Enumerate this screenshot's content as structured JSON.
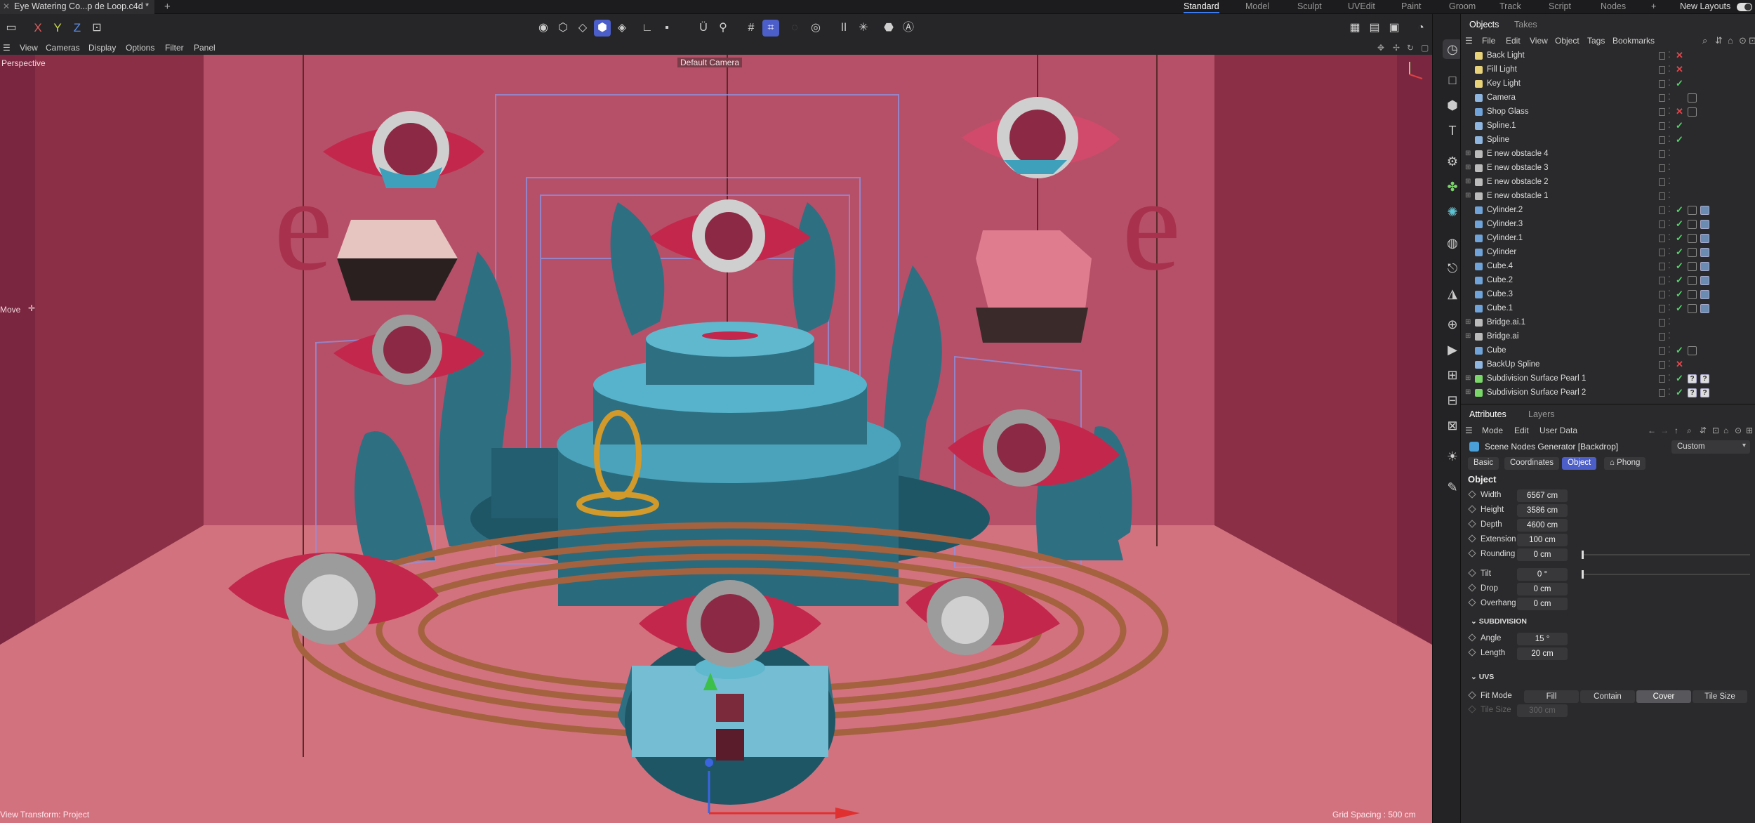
{
  "title_bar": {
    "document_tab": "Eye Watering Co...p de Loop.c4d *",
    "layouts": [
      "Standard",
      "Model",
      "Sculpt",
      "UVEdit",
      "Paint",
      "Groom",
      "Track",
      "Script",
      "Nodes"
    ],
    "active_layout": "Standard",
    "new_layouts_label": "New Layouts"
  },
  "toolbar": {
    "axis_x": "X",
    "axis_y": "Y",
    "axis_z": "Z"
  },
  "view_menu": [
    "View",
    "Cameras",
    "Display",
    "Options",
    "Filter",
    "Panel"
  ],
  "viewport": {
    "view_name": "Perspective",
    "camera_label": "Default Camera",
    "tool_label": "Move",
    "status_left": "View Transform: Project",
    "status_right": "Grid Spacing : 500 cm",
    "colors": {
      "wall": "#b9546c",
      "floor": "#d27380",
      "teal": "#2f6f82",
      "light_teal": "#6fb6cb",
      "eye_red": "#c3284c",
      "copper": "#a4623e"
    }
  },
  "object_manager": {
    "tabs": [
      "Objects",
      "Takes"
    ],
    "menu": [
      "File",
      "Edit",
      "View",
      "Object",
      "Tags",
      "Bookmarks"
    ],
    "objects": [
      {
        "name": "Back Light",
        "icon": "light-icon",
        "state": "cross",
        "tags": []
      },
      {
        "name": "Fill Light",
        "icon": "light-icon",
        "state": "cross",
        "tags": []
      },
      {
        "name": "Key Light",
        "icon": "light-icon",
        "state": "check",
        "tags": []
      },
      {
        "name": "Camera",
        "icon": "camera-icon",
        "state": "none",
        "tags": [
          "target"
        ]
      },
      {
        "name": "Shop Glass",
        "icon": "object-icon",
        "state": "cross",
        "tags": [
          "flag"
        ]
      },
      {
        "name": "Spline.1",
        "icon": "spline-icon",
        "state": "check",
        "tags": []
      },
      {
        "name": "Spline",
        "icon": "spline-icon",
        "state": "check",
        "tags": []
      },
      {
        "name": "E new obstacle 4",
        "icon": "null-icon",
        "state": "none",
        "tags": []
      },
      {
        "name": "E new obstacle 3",
        "icon": "null-icon",
        "state": "none",
        "tags": []
      },
      {
        "name": "E new obstacle 2",
        "icon": "null-icon",
        "state": "none",
        "tags": []
      },
      {
        "name": "E new obstacle 1",
        "icon": "null-icon",
        "state": "none",
        "tags": []
      },
      {
        "name": "Cylinder.2",
        "icon": "cylinder-icon",
        "state": "check",
        "tags": [
          "flag",
          "material"
        ]
      },
      {
        "name": "Cylinder.3",
        "icon": "cylinder-icon",
        "state": "check",
        "tags": [
          "flag",
          "material"
        ]
      },
      {
        "name": "Cylinder.1",
        "icon": "cylinder-icon",
        "state": "check",
        "tags": [
          "flag",
          "material"
        ]
      },
      {
        "name": "Cylinder",
        "icon": "cylinder-icon",
        "state": "check",
        "tags": [
          "flag",
          "material"
        ]
      },
      {
        "name": "Cube.4",
        "icon": "cube-icon",
        "state": "check",
        "tags": [
          "flag",
          "material"
        ]
      },
      {
        "name": "Cube.2",
        "icon": "cube-icon",
        "state": "check",
        "tags": [
          "flag",
          "material"
        ]
      },
      {
        "name": "Cube.3",
        "icon": "cube-icon",
        "state": "check",
        "tags": [
          "flag",
          "material"
        ]
      },
      {
        "name": "Cube.1",
        "icon": "cube-icon",
        "state": "check",
        "tags": [
          "flag",
          "material"
        ]
      },
      {
        "name": "Bridge.ai.1",
        "icon": "null-icon",
        "state": "none",
        "tags": []
      },
      {
        "name": "Bridge.ai",
        "icon": "null-icon",
        "state": "none",
        "tags": []
      },
      {
        "name": "Cube",
        "icon": "cube-icon",
        "state": "check",
        "tags": [
          "flag"
        ]
      },
      {
        "name": "BackUp Spline",
        "icon": "spline-icon",
        "state": "cross",
        "tags": []
      },
      {
        "name": "Subdivision Surface Pearl 1",
        "icon": "subdivision-icon",
        "state": "check",
        "tags": [
          "question",
          "question"
        ]
      },
      {
        "name": "Subdivision Surface Pearl 2",
        "icon": "subdivision-icon",
        "state": "check",
        "tags": [
          "question",
          "question"
        ]
      }
    ],
    "question_tag_text": "?"
  },
  "attributes": {
    "tabs": [
      "Attributes",
      "Layers"
    ],
    "menu": [
      "Mode",
      "Edit",
      "User Data"
    ],
    "object_name": "Scene Nodes Generator [Backdrop]",
    "preset": "Custom",
    "subtabs": [
      "Basic",
      "Coordinates",
      "Object",
      "Phong"
    ],
    "active_subtab": "Object",
    "section": "Object",
    "params": [
      {
        "label": "Width",
        "value": "6567 cm"
      },
      {
        "label": "Height",
        "value": "3586 cm"
      },
      {
        "label": "Depth",
        "value": "4600 cm"
      },
      {
        "label": "Extension",
        "value": "100 cm"
      },
      {
        "label": "Rounding",
        "value": "0 cm"
      },
      {
        "label": "Tilt",
        "value": "0 °"
      },
      {
        "label": "Drop",
        "value": "0 cm"
      },
      {
        "label": "Overhang",
        "value": "0 cm"
      }
    ],
    "subdivision_title": "SUBDIVISION",
    "subdivision": [
      {
        "label": "Angle",
        "value": "15 °"
      },
      {
        "label": "Length",
        "value": "20 cm"
      }
    ],
    "uvs_title": "UVS",
    "fit_mode_label": "Fit Mode",
    "fit_modes": [
      "Fill",
      "Contain",
      "Cover",
      "Tile Size"
    ],
    "active_fit_mode": "Cover",
    "tile_size_label": "Tile Size",
    "tile_size_value": "300 cm"
  }
}
